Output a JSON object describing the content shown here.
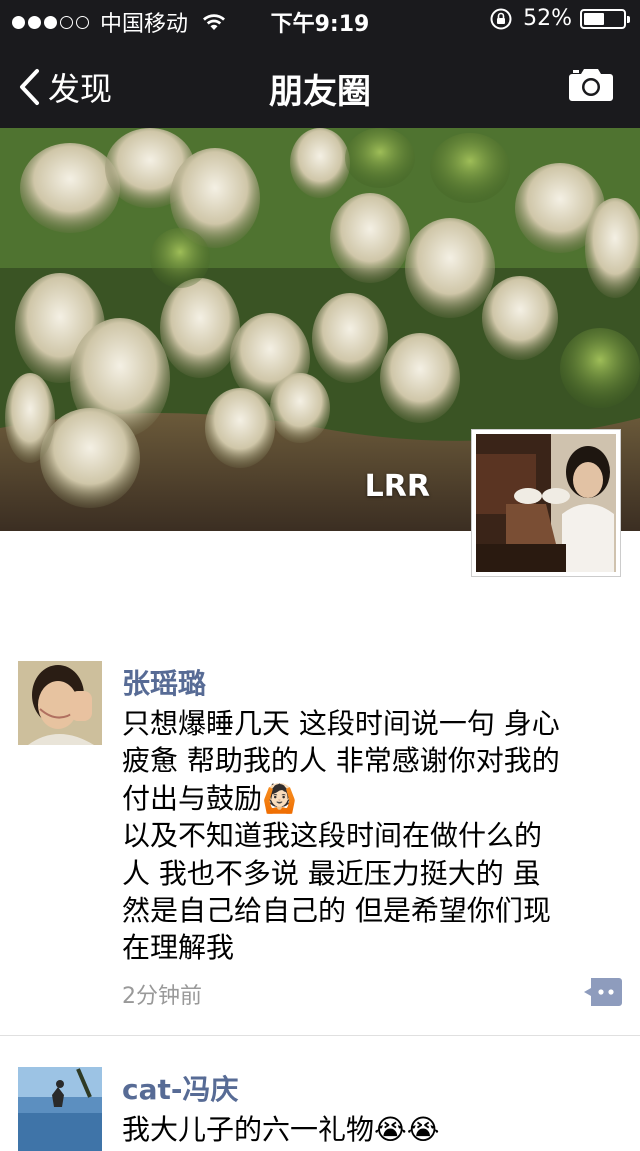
{
  "status_bar": {
    "carrier": "中国移动",
    "time": "下午9:19",
    "battery_pct": "52%",
    "battery_level": 0.52,
    "signal_bars_filled": 3,
    "signal_bars_total": 5
  },
  "nav": {
    "back_label": "发现",
    "title": "朋友圈",
    "back_icon": "chevron-left-icon",
    "camera_icon": "camera-icon"
  },
  "cover": {
    "user_name": "LRR"
  },
  "posts": [
    {
      "author": "张瑶璐",
      "text_lines": [
        "只想爆睡几天 这段时间说一句 身心",
        "疲惫 帮助我的人 非常感谢你对我的",
        "付出与鼓励🙆🏻",
        "以及不知道我这段时间在做什么的",
        "人 我也不多说 最近压力挺大的 虽",
        "然是自己给自己的 但是希望你们现",
        "在理解我"
      ],
      "time": "2分钟前"
    },
    {
      "author": "cat-冯庆",
      "text_lines": [
        "我大儿子的六一礼物😭😭"
      ],
      "time": ""
    }
  ],
  "colors": {
    "bar_background": "#1a1a1d",
    "author_name": "#576b95",
    "timestamp": "#999999",
    "comment_button": "#8e9cbd"
  }
}
